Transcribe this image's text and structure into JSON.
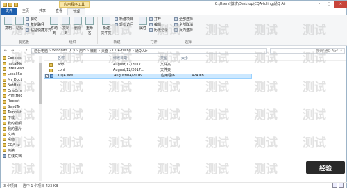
{
  "title": "C:\\Users\\微软\\Desktop\\CQA-tuling\\通Q Air",
  "context_tab": "应用程序工具",
  "tabs": [
    "文件",
    "主页",
    "共享",
    "查看",
    "管理"
  ],
  "ribbon": {
    "clipboard": {
      "copy": "复制",
      "paste": "粘贴",
      "cut": "剪切",
      "copy_path": "复制路径",
      "paste_shortcut": "粘贴快捷方式",
      "label": "剪贴板"
    },
    "organize": {
      "move_to": "移动到",
      "copy_to": "复制到",
      "delete": "删除",
      "rename": "重命名",
      "label": "组织"
    },
    "new": {
      "new_folder": "新建\n文件夹",
      "new_item": "新建项目",
      "easy_access": "轻松访问",
      "label": "新建"
    },
    "open": {
      "properties": "属性",
      "open": "打开",
      "edit": "编辑",
      "history": "历史记录",
      "label": "打开"
    },
    "select": {
      "select_all": "全部选择",
      "select_none": "全部取消",
      "invert": "反向选择",
      "label": "选择"
    }
  },
  "breadcrumbs": [
    "这台电脑",
    "Windows (C:)",
    "用户",
    "微软",
    "桌面",
    "CQA-tuling",
    "通Q Air"
  ],
  "search_placeholder": "搜索\"通Q Air\"",
  "nav_items": [
    {
      "label": "Cookies",
      "drv": false
    },
    {
      "label": "InstalMe",
      "drv": false
    },
    {
      "label": "IntelGrap",
      "drv": false
    },
    {
      "label": "Local Se",
      "drv": false
    },
    {
      "label": "My Doct",
      "drv": false
    },
    {
      "label": "NetHoo",
      "drv": false
    },
    {
      "label": "OneDriv",
      "drv": false
    },
    {
      "label": "PrintHoc",
      "drv": false
    },
    {
      "label": "Recent",
      "drv": false
    },
    {
      "label": "SendTo",
      "drv": false
    },
    {
      "label": "Templat",
      "drv": false
    },
    {
      "label": "下载",
      "drv": false
    },
    {
      "label": "我的视频",
      "drv": false
    },
    {
      "label": "我的图片",
      "drv": false
    },
    {
      "label": "文档",
      "drv": false
    },
    {
      "label": "桌面",
      "drv": false
    },
    {
      "label": "CQA-tu",
      "drv": false
    },
    {
      "label": "链接",
      "drv": false
    },
    {
      "label": "在线文档",
      "drv": true
    }
  ],
  "columns": {
    "name": "名称",
    "date": "修改日期",
    "type": "类型",
    "size": "大小"
  },
  "files": [
    {
      "name": "app",
      "date": "August/12/2017...",
      "type": "文件夹",
      "size": "",
      "kind": "folder",
      "selected": false
    },
    {
      "name": "conf",
      "date": "August/12/2017...",
      "type": "文件夹",
      "size": "",
      "kind": "folder",
      "selected": false
    },
    {
      "name": "CQA.exe",
      "date": "August/04/2016...",
      "type": "应用程序",
      "size": "424 KB",
      "kind": "exe",
      "selected": true
    }
  ],
  "status": {
    "count": "3 个项目",
    "selected": "选中 1 个项目 423 KB"
  },
  "watermark": "测试",
  "logo_text": "经验"
}
